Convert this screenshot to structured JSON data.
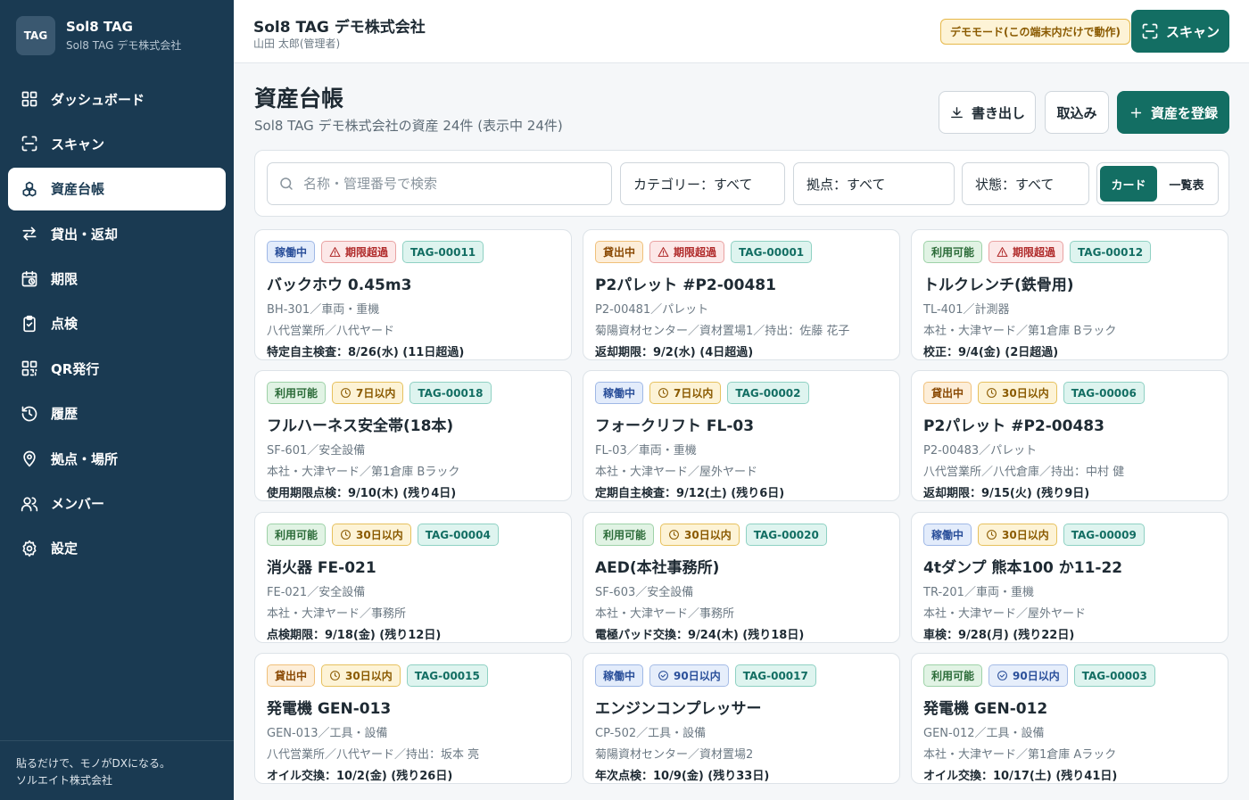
{
  "sidebar": {
    "logo_text": "TAG",
    "brand_name": "Sol8 TAG",
    "brand_sub": "Sol8 TAG デモ株式会社",
    "items": [
      {
        "label": "ダッシュボード",
        "icon": "dashboard-icon"
      },
      {
        "label": "スキャン",
        "icon": "scan-icon"
      },
      {
        "label": "資産台帳",
        "icon": "assets-icon",
        "active": true
      },
      {
        "label": "貸出・返却",
        "icon": "transfer-icon"
      },
      {
        "label": "期限",
        "icon": "calendar-clock-icon"
      },
      {
        "label": "点検",
        "icon": "clipboard-check-icon"
      },
      {
        "label": "QR発行",
        "icon": "qr-icon"
      },
      {
        "label": "履歴",
        "icon": "history-icon"
      },
      {
        "label": "拠点・場所",
        "icon": "location-pin-icon"
      },
      {
        "label": "メンバー",
        "icon": "users-icon"
      },
      {
        "label": "設定",
        "icon": "gear-icon"
      }
    ],
    "footer_line1": "貼るだけで、モノがDXになる。",
    "footer_line2": "ソルエイト株式会社"
  },
  "header": {
    "org_name": "Sol8 TAG デモ株式会社",
    "user": "山田 太郎(管理者)",
    "demo_badge": "デモモード(この端末内だけで動作)",
    "scan_label": "スキャン"
  },
  "page": {
    "title": "資産台帳",
    "subtitle": "Sol8 TAG デモ株式会社の資産 24件 (表示中 24件)",
    "export_label": "書き出し",
    "import_label": "取込み",
    "register_label": "資産を登録"
  },
  "filters": {
    "search_placeholder": "名称・管理番号で検索",
    "category": "カテゴリー：すべて",
    "location": "拠点：すべて",
    "status": "状態：すべて",
    "view_card": "カード",
    "view_list": "一覧表"
  },
  "colors": {
    "sidebar_bg": "#1a3a52",
    "primary": "#136e63",
    "demo_badge_bg": "#fdf3d6"
  },
  "cards": [
    {
      "status": "稼働中",
      "status_style": "blue",
      "deadline": "期限超過",
      "deadline_style": "red",
      "deadline_icon": "warning-icon",
      "tag": "TAG-00011",
      "name": "バックホウ 0.45m3",
      "line1": "BH-301／車両・重機",
      "line2": "八代営業所／八代ヤード",
      "line3": "特定自主検査：8/26(水) (11日超過)"
    },
    {
      "status": "貸出中",
      "status_style": "orange",
      "deadline": "期限超過",
      "deadline_style": "red",
      "deadline_icon": "warning-icon",
      "tag": "TAG-00001",
      "name": "P2パレット #P2-00481",
      "line1": "P2-00481／パレット",
      "line2": "菊陽資材センター／資材置場1／持出：佐藤 花子",
      "line3": "返却期限：9/2(水) (4日超過)"
    },
    {
      "status": "利用可能",
      "status_style": "green",
      "deadline": "期限超過",
      "deadline_style": "red",
      "deadline_icon": "warning-icon",
      "tag": "TAG-00012",
      "name": "トルクレンチ(鉄骨用)",
      "line1": "TL-401／計測器",
      "line2": "本社・大津ヤード／第1倉庫 Bラック",
      "line3": "校正：9/4(金) (2日超過)"
    },
    {
      "status": "利用可能",
      "status_style": "green",
      "deadline": "7日以内",
      "deadline_style": "yellow",
      "deadline_icon": "clock-icon",
      "tag": "TAG-00018",
      "name": "フルハーネス安全帯(18本)",
      "line1": "SF-601／安全設備",
      "line2": "本社・大津ヤード／第1倉庫 Bラック",
      "line3": "使用期限点検：9/10(木) (残り4日)"
    },
    {
      "status": "稼働中",
      "status_style": "blue",
      "deadline": "7日以内",
      "deadline_style": "yellow",
      "deadline_icon": "clock-icon",
      "tag": "TAG-00002",
      "name": "フォークリフト FL-03",
      "line1": "FL-03／車両・重機",
      "line2": "本社・大津ヤード／屋外ヤード",
      "line3": "定期自主検査：9/12(土) (残り6日)"
    },
    {
      "status": "貸出中",
      "status_style": "orange",
      "deadline": "30日以内",
      "deadline_style": "yellow",
      "deadline_icon": "clock-icon",
      "tag": "TAG-00006",
      "name": "P2パレット #P2-00483",
      "line1": "P2-00483／パレット",
      "line2": "八代営業所／八代倉庫／持出：中村 健",
      "line3": "返却期限：9/15(火) (残り9日)"
    },
    {
      "status": "利用可能",
      "status_style": "green",
      "deadline": "30日以内",
      "deadline_style": "yellow",
      "deadline_icon": "clock-icon",
      "tag": "TAG-00004",
      "name": "消火器 FE-021",
      "line1": "FE-021／安全設備",
      "line2": "本社・大津ヤード／事務所",
      "line3": "点検期限：9/18(金) (残り12日)"
    },
    {
      "status": "利用可能",
      "status_style": "green",
      "deadline": "30日以内",
      "deadline_style": "yellow",
      "deadline_icon": "clock-icon",
      "tag": "TAG-00020",
      "name": "AED(本社事務所)",
      "line1": "SF-603／安全設備",
      "line2": "本社・大津ヤード／事務所",
      "line3": "電極パッド交換：9/24(木) (残り18日)"
    },
    {
      "status": "稼働中",
      "status_style": "blue",
      "deadline": "30日以内",
      "deadline_style": "yellow",
      "deadline_icon": "clock-icon",
      "tag": "TAG-00009",
      "name": "4tダンプ 熊本100 か11-22",
      "line1": "TR-201／車両・重機",
      "line2": "本社・大津ヤード／屋外ヤード",
      "line3": "車検：9/28(月) (残り22日)"
    },
    {
      "status": "貸出中",
      "status_style": "orange",
      "deadline": "30日以内",
      "deadline_style": "yellow",
      "deadline_icon": "clock-icon",
      "tag": "TAG-00015",
      "name": "発電機 GEN-013",
      "line1": "GEN-013／工具・設備",
      "line2": "八代営業所／八代ヤード／持出：坂本 亮",
      "line3": "オイル交換：10/2(金) (残り26日)"
    },
    {
      "status": "稼働中",
      "status_style": "blue",
      "deadline": "90日以内",
      "deadline_style": "blue",
      "deadline_icon": "check-circle-icon",
      "tag": "TAG-00017",
      "name": "エンジンコンプレッサー",
      "line1": "CP-502／工具・設備",
      "line2": "菊陽資材センター／資材置場2",
      "line3": "年次点検：10/9(金) (残り33日)"
    },
    {
      "status": "利用可能",
      "status_style": "green",
      "deadline": "90日以内",
      "deadline_style": "blue",
      "deadline_icon": "check-circle-icon",
      "tag": "TAG-00003",
      "name": "発電機 GEN-012",
      "line1": "GEN-012／工具・設備",
      "line2": "本社・大津ヤード／第1倉庫 Aラック",
      "line3": "オイル交換：10/17(土) (残り41日)"
    }
  ]
}
